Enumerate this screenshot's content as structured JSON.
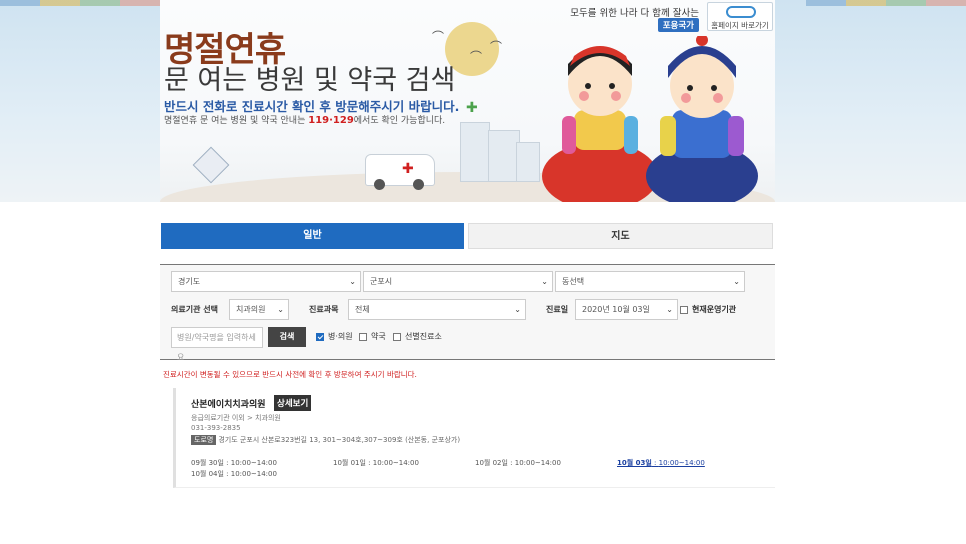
{
  "banner": {
    "title_line1": "명절연휴",
    "title_line2": "문 여는 병원 및 약국 검색",
    "sub_line1": "반드시 전화로 진료시간 확인 후 방문해주시기 바랍니다.",
    "sub_line2_prefix": "명절연휴 문 여는 병원 및 약국 안내는 ",
    "sub_line2_phone": "119·129",
    "sub_line2_suffix": "에서도 확인 가능합니다.",
    "top_right_text": "모두를 위한 나라 다 함께 잘사는",
    "pill_text": "포용국가",
    "home_link_text": "홈페이지 바로가기"
  },
  "tabs": [
    {
      "label": "일반",
      "active": true
    },
    {
      "label": "지도",
      "active": false
    }
  ],
  "filters": {
    "province": "경기도",
    "city": "군포시",
    "dong": "동선택",
    "facility_label": "의료기관 선택",
    "facility_value": "치과의원",
    "dept_label": "진료과목",
    "dept_value": "전체",
    "date_label": "진료일",
    "date_value": "2020년 10월 03일",
    "open_now_label": "현재운영기관",
    "search_placeholder": "병원/약국명을 입력하세요",
    "search_button": "검색",
    "check_hospital": "병·의원",
    "check_pharmacy": "약국",
    "check_screening": "선별진료소"
  },
  "notice": "진료시간이 변동될 수 있으므로 반드시 사전에 확인 후 방문하여 주시기 바랍니다.",
  "results": [
    {
      "name": "산본에이치치과의원",
      "detail_button": "상세보기",
      "category": "응급의료기관 이외 > 치과의원",
      "phone": "031-393-2835",
      "road_tag": "도로명",
      "address": "경기도 군포시 산본로323번길 13, 301~304호,307~309호 (산본동, 군포상가)",
      "hours": [
        {
          "date": "09월 30일",
          "time": "10:00~14:00"
        },
        {
          "date": "10월 01일",
          "time": "10:00~14:00"
        },
        {
          "date": "10월 02일",
          "time": "10:00~14:00"
        },
        {
          "date": "10월 03일",
          "time": "10:00~14:00"
        },
        {
          "date": "10월 04일",
          "time": "10:00~14:00"
        }
      ]
    }
  ],
  "colors": {
    "accent": "#1f6bc0",
    "title_brown": "#8a3b1c",
    "notice_red": "#d02020"
  }
}
